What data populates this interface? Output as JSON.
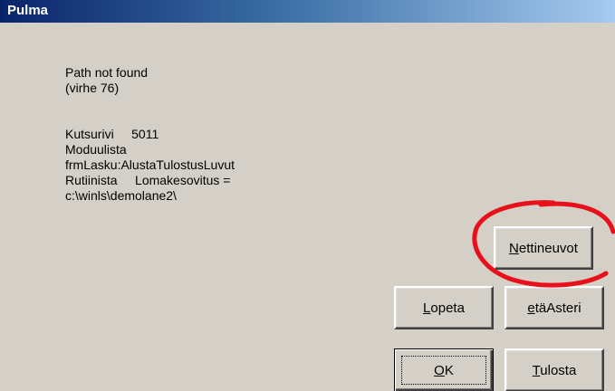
{
  "window": {
    "title": "Pulma"
  },
  "message": {
    "line1": "Path not found",
    "line2": "(virhe 76)",
    "line3": "Kutsurivi     5011",
    "line4": "Moduulista",
    "line5": "frmLasku:AlustaTulostusLuvut",
    "line6": "Rutiinista     Lomakesovitus =",
    "line7": "c:\\winls\\demolane2\\"
  },
  "buttons": {
    "nettineuvot": {
      "mnemonic": "N",
      "rest": "ettineuvot"
    },
    "lopeta": {
      "mnemonic": "L",
      "rest": "opeta"
    },
    "etaasteri": {
      "mnemonic": "e",
      "rest": "täAsteri"
    },
    "ok": {
      "mnemonic": "O",
      "rest": "K"
    },
    "tulosta": {
      "mnemonic": "T",
      "rest": "ulosta"
    }
  },
  "colors": {
    "titlebar_start": "#0a246a",
    "titlebar_end": "#a6caf0",
    "dialog_bg": "#d4d0c8",
    "annotation_ring": "#e8101a"
  }
}
